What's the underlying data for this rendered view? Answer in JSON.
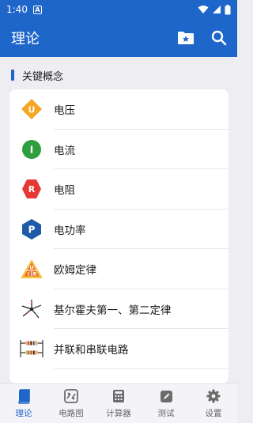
{
  "status": {
    "time": "1:40",
    "badge": "A"
  },
  "appbar": {
    "title": "理论",
    "icons": [
      "folder-star-icon",
      "search-icon"
    ]
  },
  "section": {
    "title": "关键概念"
  },
  "items": [
    {
      "label": "电压",
      "icon": "voltage-icon",
      "icon_text": "U",
      "color": "#f5a623"
    },
    {
      "label": "电流",
      "icon": "current-icon",
      "icon_text": "I",
      "color": "#2e9e3e"
    },
    {
      "label": "电阻",
      "icon": "resistance-icon",
      "icon_text": "R",
      "color": "#e53935"
    },
    {
      "label": "电功率",
      "icon": "power-icon",
      "icon_text": "P",
      "color": "#1e5aa8"
    },
    {
      "label": "欧姆定律",
      "icon": "ohms-law-triangle-icon",
      "icon_text": [
        "U",
        "I",
        "R"
      ],
      "color": "#e8712a"
    },
    {
      "label": "基尔霍夫第一、第二定律",
      "icon": "kirchhoff-node-icon"
    },
    {
      "label": "并联和串联电路",
      "icon": "circuit-resistors-icon"
    },
    {
      "label": "",
      "icon": ""
    }
  ],
  "nav": {
    "tabs": [
      {
        "label": "理论",
        "icon": "book-icon",
        "active": true
      },
      {
        "label": "电路图",
        "icon": "circuit-diagram-icon",
        "active": false
      },
      {
        "label": "计算器",
        "icon": "calculator-icon",
        "active": false
      },
      {
        "label": "测试",
        "icon": "test-pencil-icon",
        "active": false
      },
      {
        "label": "设置",
        "icon": "settings-gear-icon",
        "active": false
      }
    ]
  },
  "colors": {
    "primary": "#1e66c9",
    "background": "#eeeef2"
  }
}
